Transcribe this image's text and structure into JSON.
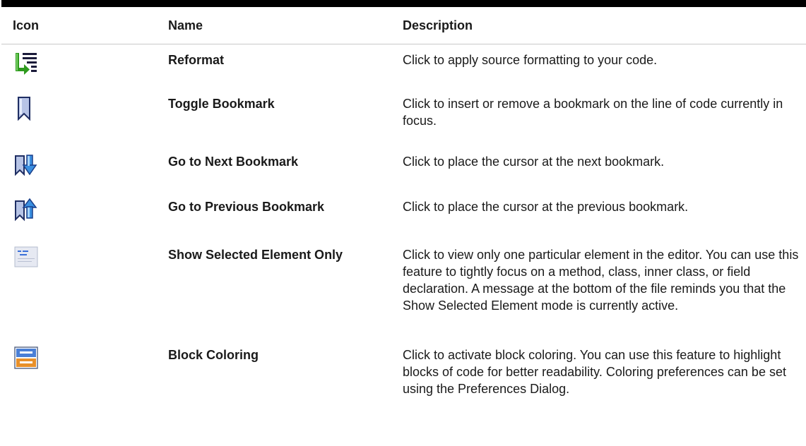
{
  "table": {
    "headers": {
      "icon": "Icon",
      "name": "Name",
      "description": "Description"
    },
    "rows": [
      {
        "icon": "reformat-icon",
        "name": "Reformat",
        "description": "Click to apply source formatting to your code."
      },
      {
        "icon": "bookmark-icon",
        "name": "Toggle Bookmark",
        "description": "Click to insert or remove a bookmark on the line of code currently in focus."
      },
      {
        "icon": "next-bookmark-icon",
        "name": "Go to Next Bookmark",
        "description": "Click to place the cursor at the next bookmark."
      },
      {
        "icon": "previous-bookmark-icon",
        "name": "Go to Previous Bookmark",
        "description": "Click to place the cursor at the previous bookmark."
      },
      {
        "icon": "show-selected-element-icon",
        "name": "Show Selected Element Only",
        "description": "Click to view only one particular element in the editor. You can use this feature to tightly focus on a method, class, inner class, or field declaration. A message at the bottom of the file reminds you that the Show Selected Element mode is currently active."
      },
      {
        "icon": "block-coloring-icon",
        "name": "Block Coloring",
        "description": "Click to activate block coloring. You can use this feature to highlight blocks of code for better readability. Coloring preferences can be set using the Preferences Dialog."
      }
    ]
  }
}
